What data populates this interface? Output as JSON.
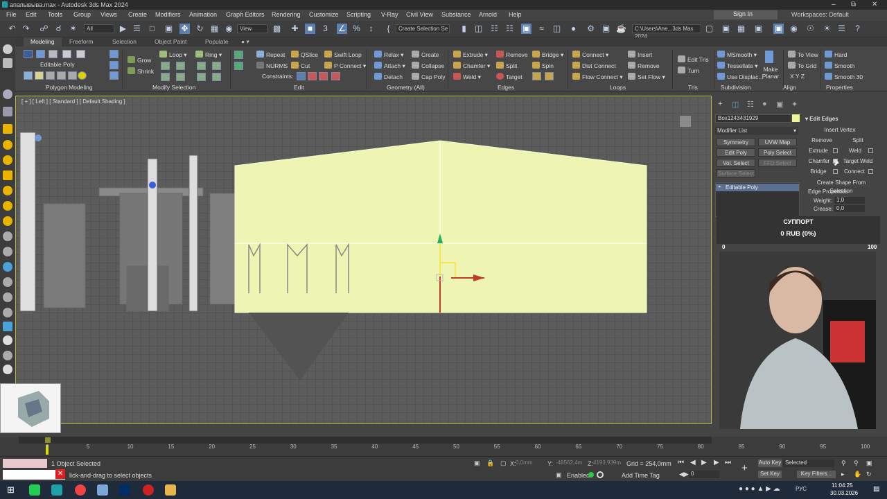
{
  "window": {
    "title": "апапывыва.max - Autodesk 3ds Max 2024"
  },
  "menu": [
    "File",
    "Edit",
    "Tools",
    "Group",
    "Views",
    "Create",
    "Modifiers",
    "Animation",
    "Graph Editors",
    "Rendering",
    "Customize",
    "Scripting",
    "V-Ray",
    "Civil View",
    "Substance",
    "Arnold",
    "Help"
  ],
  "account": {
    "signin": "Sign In",
    "workspaces": "Workspaces: Default"
  },
  "toolbar": {
    "filter": "All",
    "refcoord": "View",
    "selection_set": "Create Selection Se",
    "path": "C:\\Users\\Ane...3ds Max 2024"
  },
  "ribbon_tabs": [
    "Modeling",
    "Freeform",
    "Selection",
    "Object Paint",
    "Populate"
  ],
  "ribbon": {
    "editable_poly": "Editable Poly",
    "grow": "Grow",
    "shrink": "Shrink",
    "loop": "Loop",
    "ring": "Ring",
    "repeat": "Repeat",
    "qslice": "QSlice",
    "swift_loop": "Swift Loop",
    "nurms": "NURMS",
    "cut": "Cut",
    "p_connect": "P Connect",
    "constraints": "Constraints:",
    "relax": "Relax",
    "create": "Create",
    "attach": "Attach",
    "collapse": "Collapse",
    "detach": "Detach",
    "cap_poly": "Cap Poly",
    "extrude": "Extrude",
    "remove": "Remove",
    "bridge": "Bridge",
    "chamfer": "Chamfer",
    "split": "Split",
    "spin": "Spin",
    "weld": "Weld",
    "target": "Target",
    "connect": "Connect",
    "dist_connect": "Dist Connect",
    "flow_connect": "Flow Connect",
    "insert": "Insert",
    "loops_remove": "Remove",
    "set_flow": "Set Flow",
    "edit_tris": "Edit Tris",
    "turn": "Turn",
    "msmooth": "MSmooth",
    "tessellate": "Tessellate",
    "use_displac": "Use Displac...",
    "make_planar": "Make Planar",
    "to_view": "To View",
    "to_grid": "To Grid",
    "xyz": "X  Y  Z",
    "hard": "Hard",
    "smooth": "Smooth",
    "smooth30": "Smooth 30"
  },
  "ribbon_groups": [
    "Polygon Modeling",
    "Modify Selection",
    "Edit",
    "Geometry (All)",
    "Edges",
    "Loops",
    "Tris",
    "Subdivision",
    "Align",
    "Properties"
  ],
  "viewport": {
    "label": "[ + ] [ Left ] [ Standard ] [ Default Shading ]"
  },
  "command_panel": {
    "object_name": "Box1243431929",
    "modifier_list": "Modifier List",
    "buttons": [
      "Symmetry",
      "UVW Map",
      "Edit Poly",
      "Poly Select",
      "Vol. Select",
      "FFD Select",
      "Surface Select"
    ],
    "stack_item": "Editable Poly",
    "rollout_title": "Edit Edges",
    "insert_vertex": "Insert Vertex",
    "remove": "Remove",
    "split": "Split",
    "extrude": "Extrude",
    "weld": "Weld",
    "chamfer": "Chamfer",
    "target_weld": "Target Weld",
    "bridge": "Bridge",
    "connect": "Connect",
    "create_shape": "Create Shape From Selection",
    "edge_properties": "Edge Properties",
    "weight_label": "Weight:",
    "weight": "1,0",
    "crease_label": "Crease:",
    "crease": "0,0"
  },
  "support": {
    "title": "СУППОРТ",
    "amount": "0 RUB (0%)",
    "min": "0",
    "max": "100",
    "progress": 0
  },
  "timeline": {
    "frame": "0 / 100",
    "ticks": [
      "0",
      "5",
      "10",
      "15",
      "20",
      "25",
      "30",
      "35",
      "40",
      "45",
      "50",
      "55",
      "60",
      "65",
      "70",
      "75",
      "80",
      "85",
      "90",
      "95",
      "100"
    ]
  },
  "status": {
    "selected": "1 Object Selected",
    "prompt": "lick-and-drag to select objects",
    "x_label": "X:",
    "x": "0,0mm",
    "y_label": "Y:",
    "y": "-48562,4m",
    "z_label": "Z:",
    "z": "4193,939m",
    "grid": "Grid = 254,0mm",
    "enabled": "Enabled:",
    "add_time_tag": "Add Time Tag",
    "auto_key": "Auto Key",
    "set_key": "Set Key",
    "key_mode": "Selected",
    "key_filters": "Key Filters...",
    "frame": "0"
  },
  "clock": {
    "time": "11:04:25",
    "date": "30.03.2026"
  }
}
